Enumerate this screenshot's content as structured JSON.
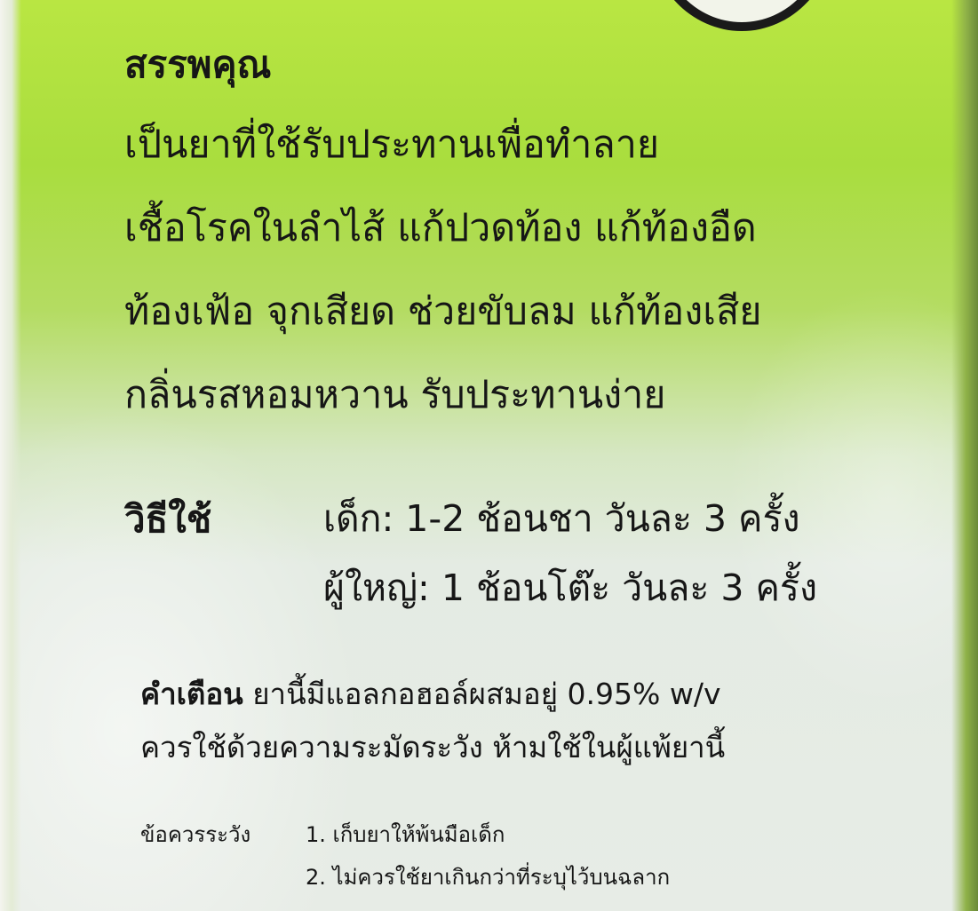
{
  "properties": {
    "heading": "สรรพคุณ",
    "lines": [
      "เป็นยาที่ใช้รับประทานเพื่อทำลาย",
      "เชื้อโรคในลำไส้ แก้ปวดท้อง แก้ท้องอืด",
      "ท้องเฟ้อ จุกเสียด ช่วยขับลม แก้ท้องเสีย",
      "กลิ่นรสหอมหวาน รับประทานง่าย"
    ]
  },
  "usage": {
    "label": "วิธีใช้",
    "lines": [
      "เด็ก: 1-2 ช้อนชา วันละ 3 ครั้ง",
      "ผู้ใหญ่: 1 ช้อนโต๊ะ วันละ 3 ครั้ง"
    ]
  },
  "warning": {
    "label": "คำเตือน",
    "line1_rest": "ยานี้มีแอลกอฮอล์ผสมอยู่ 0.95% w/v",
    "line2": "ควรใช้ด้วยความระมัดระวัง ห้ามใช้ในผู้แพ้ยานี้"
  },
  "caution": {
    "label": "ข้อควรระวัง",
    "items": [
      "1. เก็บยาให้พ้นมือเด็ก",
      "2. ไม่ควรใช้ยาเกินกว่าที่ระบุไว้บนฉลาก"
    ]
  },
  "colors": {
    "green": "#b9e642",
    "text": "#161616"
  }
}
